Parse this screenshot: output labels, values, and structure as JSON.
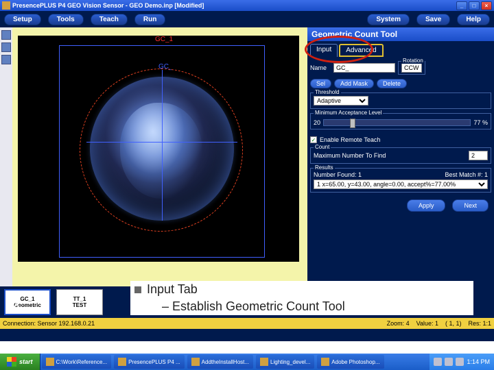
{
  "window": {
    "title": "PresencePLUS P4 GEO Vision Sensor - GEO Demo.inp [Modified]",
    "min_label": "_",
    "max_label": "□",
    "close_label": "×"
  },
  "topnav": {
    "setup": "Setup",
    "tools": "Tools",
    "teach": "Teach",
    "run": "Run",
    "system": "System",
    "save": "Save",
    "help": "Help"
  },
  "viewport": {
    "roi_label_top": "GC_1",
    "roi_label_inner": "GC_"
  },
  "panel": {
    "header": "Geometric Count Tool",
    "tabs": {
      "input": "Input",
      "advanced": "Advanced"
    },
    "name_label": "Name",
    "name_value": "GC_",
    "rotation": {
      "legend": "Rotation",
      "value": "CCW"
    },
    "btn_sel": "Sel",
    "btn_addmask": "Add Mask",
    "btn_delete": "Delete",
    "threshold": {
      "legend": "Threshold",
      "mode": "Adaptive"
    },
    "accept": {
      "legend": "Minimum Acceptance Level",
      "value": "20",
      "pct": "77 %"
    },
    "teach_checkbox": "Enable Remote Teach",
    "count": {
      "legend": "Count",
      "label": "Maximum Number To Find",
      "value": "2"
    },
    "results": {
      "legend": "Results",
      "found": "Number Found: 1",
      "best": "Best Match #: 1",
      "row": "1 x=65.00, y=43.00, angle=0.00, accept%=77.00%"
    },
    "apply": "Apply",
    "next": "Next"
  },
  "toolstrip": {
    "a_label": "A",
    "tools": [
      {
        "line1": "GC_1",
        "line2": "Geometric"
      },
      {
        "line1": "TT_1",
        "line2": "TEST"
      }
    ]
  },
  "statusbar": {
    "conn": "Connection: Sensor 192.168.0.21",
    "zoom": "Zoom: 4",
    "value": "Value: 1",
    "pos": "( 1, 1)",
    "res": "Res: 1:1"
  },
  "annotation": {
    "title": "Input Tab",
    "sub": "– Establish Geometric Count Tool"
  },
  "taskbar": {
    "start": "start",
    "items": [
      "C:\\Work\\Reference...",
      "PresencePLUS P4 ...",
      "AddtheInstallHost...",
      "Lighting_devel...",
      "Adobe Photoshop..."
    ],
    "clock": "1:14 PM"
  }
}
